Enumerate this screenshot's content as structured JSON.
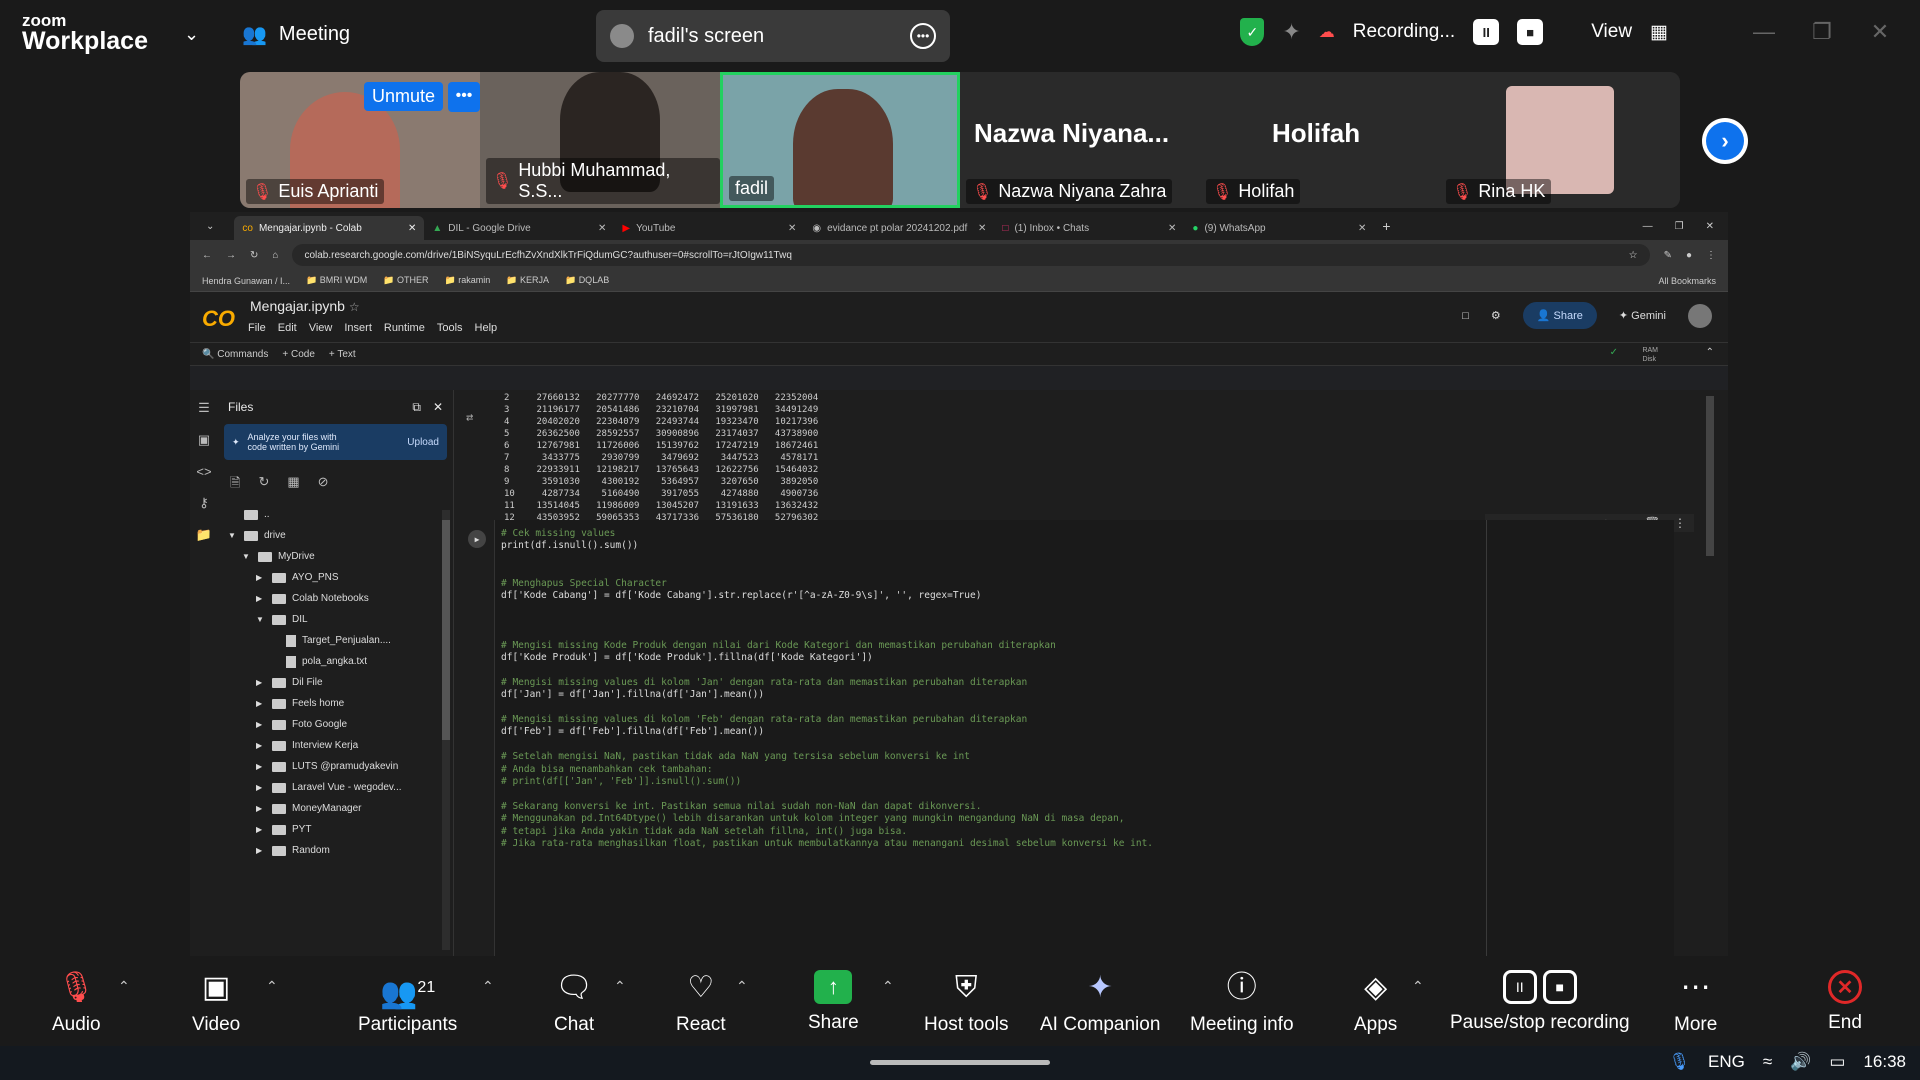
{
  "zoom": {
    "brand_small": "zoom",
    "brand_big": "Workplace",
    "meeting_label": "Meeting",
    "share_title": "fadil's screen",
    "recording_label": "Recording...",
    "view_label": "View"
  },
  "participants": {
    "unmute_label": "Unmute",
    "tiles": [
      {
        "name": "Euis Aprianti"
      },
      {
        "name": "Hubbi Muhammad, S.S..."
      },
      {
        "name": "fadil"
      },
      {
        "name": "Nazwa Niyana Zahra",
        "big": "Nazwa  Niyana..."
      },
      {
        "name": "Holifah",
        "big": "Holifah"
      },
      {
        "name": "Rina HK"
      }
    ]
  },
  "browser": {
    "tabs": [
      "Mengajar.ipynb - Colab",
      "DIL - Google Drive",
      "YouTube",
      "evidance pt polar 20241202.pdf",
      "(1) Inbox • Chats",
      "(9) WhatsApp"
    ],
    "url": "colab.research.google.com/drive/1BiNSyquLrEcfhZvXndXlkTrFiQdumGC?authuser=0#scrollTo=rJtOIgw11Twq",
    "bookmarks": [
      "Hendra Gunawan / I...",
      "BMRI WDM",
      "OTHER",
      "rakamin",
      "KERJA",
      "DQLAB"
    ],
    "all_bookmarks": "All Bookmarks"
  },
  "colab": {
    "notebook_title": "Mengajar.ipynb",
    "menus": [
      "File",
      "Edit",
      "View",
      "Insert",
      "Runtime",
      "Tools",
      "Help"
    ],
    "share_label": "Share",
    "gemini_label": "Gemini",
    "commands_label": "Commands",
    "code_label": "+ Code",
    "text_label": "+ Text",
    "ram_label": "RAM",
    "disk_label": "Disk",
    "files_title": "Files",
    "gemini_card": "Analyze your files with code written by Gemini",
    "upload_label": "Upload",
    "tree": [
      {
        "label": "..",
        "depth": 0,
        "type": "folder"
      },
      {
        "label": "drive",
        "depth": 0,
        "type": "folder",
        "arrow": "▼"
      },
      {
        "label": "MyDrive",
        "depth": 1,
        "type": "folder",
        "arrow": "▼"
      },
      {
        "label": "AYO_PNS",
        "depth": 2,
        "type": "folder",
        "arrow": "▶"
      },
      {
        "label": "Colab Notebooks",
        "depth": 2,
        "type": "folder",
        "arrow": "▶"
      },
      {
        "label": "DIL",
        "depth": 2,
        "type": "folder",
        "arrow": "▼"
      },
      {
        "label": "Target_Penjualan....",
        "depth": 3,
        "type": "file"
      },
      {
        "label": "pola_angka.txt",
        "depth": 3,
        "type": "file"
      },
      {
        "label": "Dil File",
        "depth": 2,
        "type": "folder",
        "arrow": "▶"
      },
      {
        "label": "Feels home",
        "depth": 2,
        "type": "folder",
        "arrow": "▶"
      },
      {
        "label": "Foto Google",
        "depth": 2,
        "type": "folder",
        "arrow": "▶"
      },
      {
        "label": "Interview Kerja",
        "depth": 2,
        "type": "folder",
        "arrow": "▶"
      },
      {
        "label": "LUTS @pramudyakevin",
        "depth": 2,
        "type": "folder",
        "arrow": "▶"
      },
      {
        "label": "Laravel Vue - wegodev...",
        "depth": 2,
        "type": "folder",
        "arrow": "▶"
      },
      {
        "label": "MoneyManager",
        "depth": 2,
        "type": "folder",
        "arrow": "▶"
      },
      {
        "label": "PYT",
        "depth": 2,
        "type": "folder",
        "arrow": "▶"
      },
      {
        "label": "Random",
        "depth": 2,
        "type": "folder",
        "arrow": "▶"
      }
    ],
    "output_rows": [
      "2     27660132   20277770   24692472   25201020   22352004",
      "3     21196177   20541486   23210704   31997981   34491249",
      "4     20402020   22304079   22493744   19323470   10217396",
      "5     26362500   28592557   30900896   23174037   43738900",
      "6     12767981   11726006   15139762   17247219   18672461",
      "7      3433775    2930799    3479692    3447523    4578171",
      "8     22933911   12198217   13765643   12622756   15464032",
      "9      3591030    4300192    5364957    3207650    3892050",
      "10     4287734    5160490    3917055    4274880    4900736",
      "11    13514045   11986009   13045207   13191633   13632432",
      "12    43503952   59065353   43717336   57536180   52796302"
    ],
    "code_lines": [
      {
        "t": "# Cek missing values",
        "c": true
      },
      {
        "t": "print(df.isnull().sum())",
        "c": false
      },
      {
        "t": "",
        "c": false
      },
      {
        "t": "",
        "c": false
      },
      {
        "t": "# Menghapus Special Character",
        "c": true
      },
      {
        "t": "df['Kode Cabang'] = df['Kode Cabang'].str.replace(r'[^a-zA-Z0-9\\s]', '', regex=True)",
        "c": false
      },
      {
        "t": "",
        "c": false
      },
      {
        "t": "",
        "c": false
      },
      {
        "t": "",
        "c": false
      },
      {
        "t": "# Mengisi missing Kode Produk dengan nilai dari Kode Kategori dan memastikan perubahan diterapkan",
        "c": true
      },
      {
        "t": "df['Kode Produk'] = df['Kode Produk'].fillna(df['Kode Kategori'])",
        "c": false
      },
      {
        "t": "",
        "c": false
      },
      {
        "t": "# Mengisi missing values di kolom 'Jan' dengan rata-rata dan memastikan perubahan diterapkan",
        "c": true
      },
      {
        "t": "df['Jan'] = df['Jan'].fillna(df['Jan'].mean())",
        "c": false
      },
      {
        "t": "",
        "c": false
      },
      {
        "t": "# Mengisi missing values di kolom 'Feb' dengan rata-rata dan memastikan perubahan diterapkan",
        "c": true
      },
      {
        "t": "df['Feb'] = df['Feb'].fillna(df['Feb'].mean())",
        "c": false
      },
      {
        "t": "",
        "c": false
      },
      {
        "t": "# Setelah mengisi NaN, pastikan tidak ada NaN yang tersisa sebelum konversi ke int",
        "c": true
      },
      {
        "t": "# Anda bisa menambahkan cek tambahan:",
        "c": true
      },
      {
        "t": "# print(df[['Jan', 'Feb']].isnull().sum())",
        "c": true
      },
      {
        "t": "",
        "c": false
      },
      {
        "t": "# Sekarang konversi ke int. Pastikan semua nilai sudah non-NaN dan dapat dikonversi.",
        "c": true
      },
      {
        "t": "# Menggunakan pd.Int64Dtype() lebih disarankan untuk kolom integer yang mungkin mengandung NaN di masa depan,",
        "c": true
      },
      {
        "t": "# tetapi jika Anda yakin tidak ada NaN setelah fillna, int() juga bisa.",
        "c": true
      },
      {
        "t": "# Jika rata-rata menghasilkan float, pastikan untuk membulatkannya atau menangani desimal sebelum konversi ke int.",
        "c": true
      }
    ]
  },
  "toolbar": {
    "audio": "Audio",
    "video": "Video",
    "participants": "Participants",
    "participants_count": "21",
    "chat": "Chat",
    "react": "React",
    "share": "Share",
    "host_tools": "Host tools",
    "ai_companion": "AI Companion",
    "meeting_info": "Meeting info",
    "apps": "Apps",
    "pause_recording": "Pause/stop recording",
    "more": "More",
    "end": "End"
  },
  "taskbar": {
    "lang": "ENG",
    "time": "16:38"
  }
}
